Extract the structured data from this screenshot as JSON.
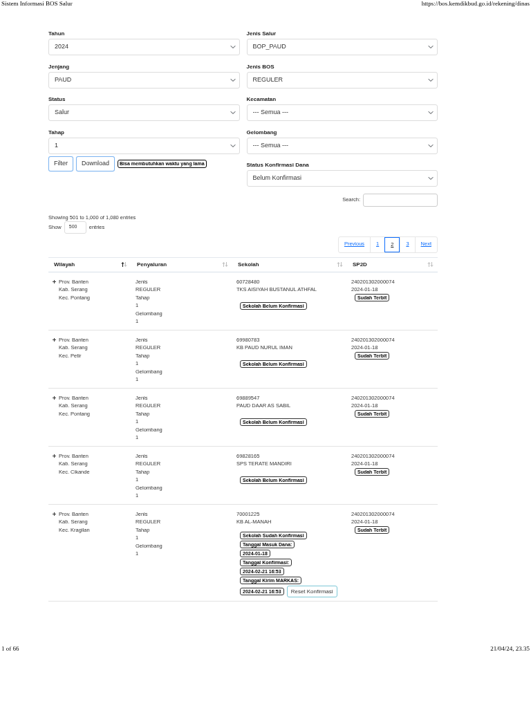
{
  "print_header": {
    "title": "Sistem Informasi BOS Salur",
    "url": "https://bos.kemdikbud.go.id/rekening/dinas"
  },
  "filters_left": [
    {
      "label": "Tahun",
      "value": "2024"
    },
    {
      "label": "Jenjang",
      "value": "PAUD"
    },
    {
      "label": "Status",
      "value": "Salur"
    },
    {
      "label": "Tahap",
      "value": "1"
    }
  ],
  "filters_right": [
    {
      "label": "Jenis Salur",
      "value": "BOP_PAUD"
    },
    {
      "label": "Jenis BOS",
      "value": "REGULER"
    },
    {
      "label": "Kecamatan",
      "value": "--- Semua ---"
    },
    {
      "label": "Gelombang",
      "value": "--- Semua ---"
    },
    {
      "label": "Status Konfirmasi Dana",
      "value": "Belum Konfirmasi"
    }
  ],
  "buttons": [
    "Filter",
    "Download"
  ],
  "download_note": "Bisa membutuhkan waktu yang lama",
  "search": {
    "label": "Search:"
  },
  "info": "Showing 501 to 1,000 of 1,080 entries",
  "length": {
    "before": "Show",
    "value": "500",
    "after": "entries"
  },
  "pagination": {
    "previous": "Previous",
    "next": "Next",
    "pages": [
      {
        "label": "1",
        "selected": false
      },
      {
        "label": "2",
        "selected": true
      },
      {
        "label": "3",
        "selected": false
      }
    ]
  },
  "table": {
    "columns": [
      {
        "label": "Wilayah",
        "sorted": true
      },
      {
        "label": "Penyaluran",
        "sorted": false
      },
      {
        "label": "Sekolah",
        "sorted": false
      },
      {
        "label": "SP2D",
        "sorted": false
      }
    ],
    "rows": [
      {
        "wilayah": [
          "Prov. Banten",
          "Kab. Serang",
          "Kec. Pontang"
        ],
        "penyaluran": [
          "Jenis",
          "REGULER",
          "Tahap",
          "1",
          "Gelombang",
          "1"
        ],
        "npsn": "60728480",
        "sekolah": "TKS AISIYAH BUSTANUL ATHFAL",
        "badges": [
          "Sekolah Belum Konfirmasi"
        ],
        "sp2d": "240201302000074",
        "sp2d_date": "2024-01-18",
        "sp2d_badge": "Sudah Terbit"
      },
      {
        "wilayah": [
          "Prov. Banten",
          "Kab. Serang",
          "Kec. Petir"
        ],
        "penyaluran": [
          "Jenis",
          "REGULER",
          "Tahap",
          "1",
          "Gelombang",
          "1"
        ],
        "npsn": "69980783",
        "sekolah": "KB PAUD NURUL IMAN",
        "badges": [
          "Sekolah Belum Konfirmasi"
        ],
        "sp2d": "240201302000074",
        "sp2d_date": "2024-01-18",
        "sp2d_badge": "Sudah Terbit"
      },
      {
        "wilayah": [
          "Prov. Banten",
          "Kab. Serang",
          "Kec. Pontang"
        ],
        "penyaluran": [
          "Jenis",
          "REGULER",
          "Tahap",
          "1",
          "Gelombang",
          "1"
        ],
        "npsn": "69889547",
        "sekolah": "PAUD DAAR AS SABIL",
        "badges": [
          "Sekolah Belum Konfirmasi"
        ],
        "sp2d": "240201302000074",
        "sp2d_date": "2024-01-18",
        "sp2d_badge": "Sudah Terbit"
      },
      {
        "wilayah": [
          "Prov. Banten",
          "Kab. Serang",
          "Kec. Cikande"
        ],
        "penyaluran": [
          "Jenis",
          "REGULER",
          "Tahap",
          "1",
          "Gelombang",
          "1"
        ],
        "npsn": "69828165",
        "sekolah": "SPS TERATE MANDIRI",
        "badges": [
          "Sekolah Belum Konfirmasi"
        ],
        "sp2d": "240201302000074",
        "sp2d_date": "2024-01-18",
        "sp2d_badge": "Sudah Terbit"
      },
      {
        "wilayah": [
          "Prov. Banten",
          "Kab. Serang",
          "Kec. Kragilan"
        ],
        "penyaluran": [
          "Jenis",
          "REGULER",
          "Tahap",
          "1",
          "Gelombang",
          "1"
        ],
        "npsn": "70001225",
        "sekolah": "KB AL-MANAH",
        "badges": [
          "Sekolah Sudah Konfirmasi",
          "Tanggal Masuk Dana:",
          "2024-01-18",
          "Tanggal Konfirmasi:",
          "2024-02-21 16:53",
          "Tanggal Kirim MARKAS:",
          "2024-02-21 16:53"
        ],
        "action": "Reset Konfirmasi",
        "sp2d": "240201302000074",
        "sp2d_date": "2024-01-18",
        "sp2d_badge": "Sudah Terbit"
      }
    ]
  },
  "print_footer": {
    "page": "1 of 66",
    "datetime": "21/04/24, 23.35"
  }
}
